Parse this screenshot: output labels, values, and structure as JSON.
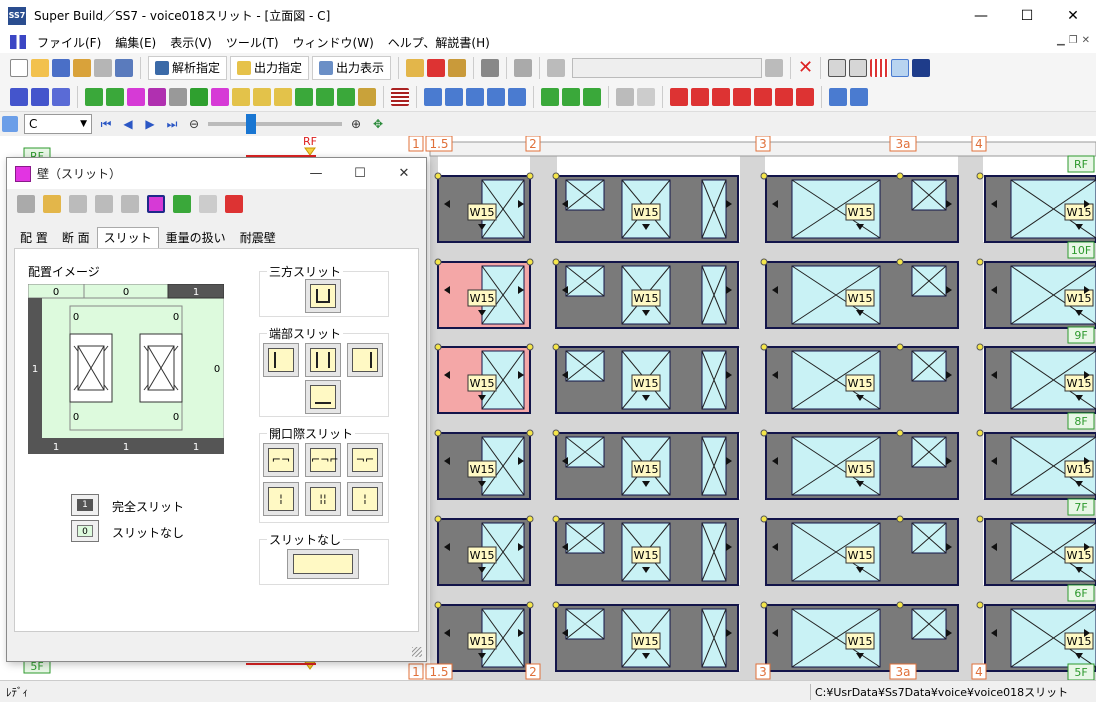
{
  "window": {
    "title": "Super Build／SS7 - voice018スリット - [立面図 - C]",
    "app_icon_text": "SS7",
    "controls": {
      "minimize": "—",
      "maximize": "☐",
      "close": "✕"
    }
  },
  "menu": {
    "items": [
      "ファイル(F)",
      "編集(E)",
      "表示(V)",
      "ツール(T)",
      "ウィンドウ(W)",
      "ヘルプ、解説書(H)"
    ]
  },
  "toolbar": {
    "analysis_label": "解析指定",
    "output_label": "出力指定",
    "output_display_label": "出力表示"
  },
  "nav": {
    "frame_value": "C"
  },
  "elevation": {
    "grid_top": [
      "1",
      "1.5",
      "2",
      "3",
      "3a",
      "4"
    ],
    "floors_right": [
      "RF",
      "10F",
      "9F",
      "8F",
      "7F",
      "6F",
      "5F"
    ],
    "left_floor_labels": [
      "RF",
      "5F"
    ],
    "rf_marker": "RF",
    "wall_label": "W15"
  },
  "dialog": {
    "title": "壁（スリット）",
    "tabs": [
      "配 置",
      "断 面",
      "スリット",
      "重量の扱い",
      "耐震壁"
    ],
    "active_tab": 2,
    "preview_label": "配置イメージ",
    "preview_values": {
      "top": [
        "0",
        "0",
        "1"
      ],
      "left": "1",
      "right": "0",
      "bottom": [
        "1",
        "1",
        "1"
      ],
      "inner": [
        "0",
        "0",
        "0",
        "0"
      ]
    },
    "three_side_label": "三方スリット",
    "end_slit_label": "端部スリット",
    "opening_slit_label": "開口際スリット",
    "no_slit_label": "スリットなし",
    "legend": [
      {
        "value": "1",
        "label": "完全スリット"
      },
      {
        "value": "0",
        "label": "スリットなし"
      }
    ]
  },
  "status": {
    "left": "ﾚﾃﾞｨ",
    "path": "C:¥UsrData¥Ss7Data¥voice¥voice018スリット"
  },
  "colors": {
    "wall_gray": "#7a7a7a",
    "wall_pink": "#f4a7a7",
    "opening_cyan": "#c9f2f5",
    "frame_navy": "#13154a",
    "floor_green_bg": "#e8f7e6",
    "floor_green_text": "#2e9a2e",
    "grid_orange": "#e0703a",
    "column_gray": "#d6d6d6",
    "label_bg": "#fff9c4",
    "node_yellow": "#f5e64a",
    "preview_green": "#ddfadd"
  }
}
